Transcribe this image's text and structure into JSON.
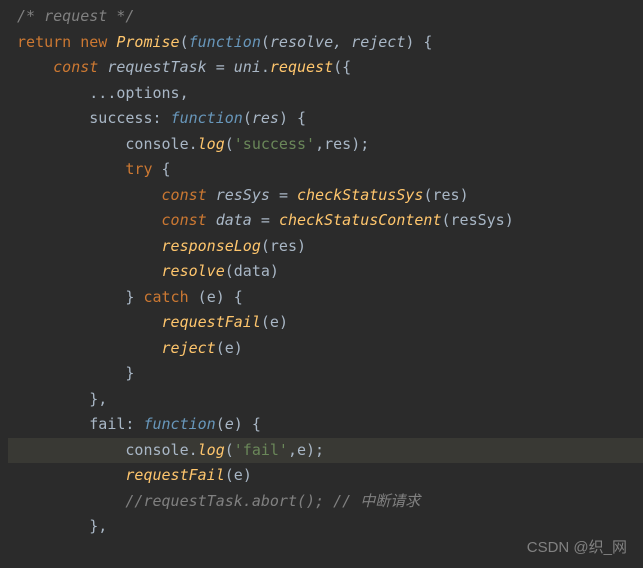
{
  "code": {
    "l1": "/* request */",
    "l2_return": "return",
    "l2_new": "new",
    "l2_promise": "Promise",
    "l2_function": "function",
    "l2_params": "resolve, reject",
    "l3_const": "const",
    "l3_var": "requestTask",
    "l3_obj": "uni",
    "l3_method": "request",
    "l4_spread": "...options,",
    "l5_prop": "success",
    "l5_function": "function",
    "l5_param": "res",
    "l6_obj": "console",
    "l6_method": "log",
    "l6_str": "'success'",
    "l6_arg": "res",
    "l7_try": "try",
    "l8_const": "const",
    "l8_var": "resSys",
    "l8_fn": "checkStatusSys",
    "l8_arg": "res",
    "l9_const": "const",
    "l9_var": "data",
    "l9_fn": "checkStatusContent",
    "l9_arg": "resSys",
    "l10_fn": "responseLog",
    "l10_arg": "res",
    "l11_fn": "resolve",
    "l11_arg": "data",
    "l12_catch": "catch",
    "l12_param": "e",
    "l13_fn": "requestFail",
    "l13_arg": "e",
    "l14_fn": "reject",
    "l14_arg": "e",
    "l17_prop": "fail",
    "l17_function": "function",
    "l17_param": "e",
    "l18_obj": "console",
    "l18_method": "log",
    "l18_str": "'fail'",
    "l18_arg": "e",
    "l19_fn": "requestFail",
    "l19_arg": "e",
    "l20_comment": "//requestTask.abort(); // 中断请求"
  },
  "watermark": "CSDN @织_网"
}
